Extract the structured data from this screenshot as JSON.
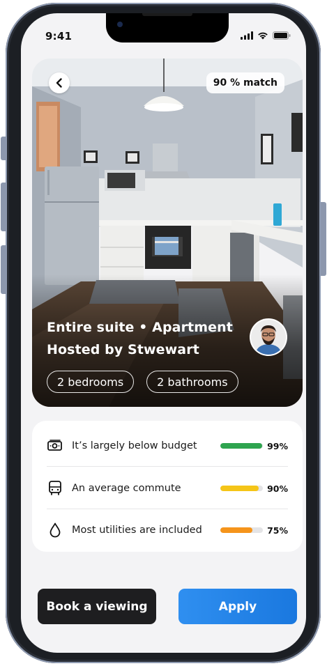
{
  "status_bar": {
    "time": "9:41",
    "icons": [
      "cellular-signal-icon",
      "wifi-icon",
      "battery-icon"
    ]
  },
  "listing": {
    "match_badge": "90 % match",
    "title_line1": "Entire suite • Apartment",
    "title_line2": "Hosted by Stwewart",
    "tags": [
      "2 bedrooms",
      "2 bathrooms"
    ],
    "host_avatar": "host-avatar"
  },
  "stats": [
    {
      "icon": "cash-icon",
      "label": "It’s largely below budget",
      "percent": "99%",
      "value": 0.99,
      "color": "#2ea44f"
    },
    {
      "icon": "bus-icon",
      "label": "An average commute",
      "percent": "90%",
      "value": 0.9,
      "color": "#f5c518"
    },
    {
      "icon": "water-drop-icon",
      "label": "Most utilities are included",
      "percent": "75%",
      "value": 0.75,
      "color": "#f5941b"
    }
  ],
  "actions": {
    "book_label": "Book a viewing",
    "apply_label": "Apply"
  },
  "colors": {
    "apply_blue": "#1a78df",
    "book_dark": "#1e1e20",
    "screen_bg": "#f3f3f5"
  }
}
